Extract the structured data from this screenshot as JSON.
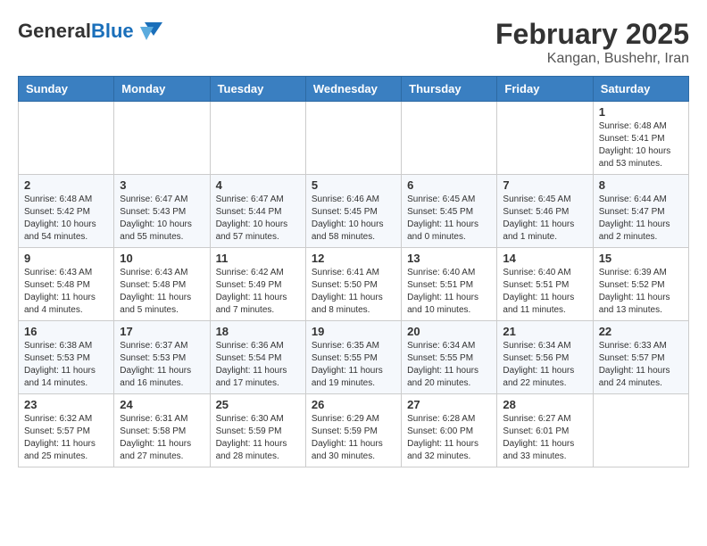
{
  "header": {
    "logo_general": "General",
    "logo_blue": "Blue",
    "month_year": "February 2025",
    "location": "Kangan, Bushehr, Iran"
  },
  "weekdays": [
    "Sunday",
    "Monday",
    "Tuesday",
    "Wednesday",
    "Thursday",
    "Friday",
    "Saturday"
  ],
  "weeks": [
    [
      {
        "day": "",
        "info": ""
      },
      {
        "day": "",
        "info": ""
      },
      {
        "day": "",
        "info": ""
      },
      {
        "day": "",
        "info": ""
      },
      {
        "day": "",
        "info": ""
      },
      {
        "day": "",
        "info": ""
      },
      {
        "day": "1",
        "info": "Sunrise: 6:48 AM\nSunset: 5:41 PM\nDaylight: 10 hours\nand 53 minutes."
      }
    ],
    [
      {
        "day": "2",
        "info": "Sunrise: 6:48 AM\nSunset: 5:42 PM\nDaylight: 10 hours\nand 54 minutes."
      },
      {
        "day": "3",
        "info": "Sunrise: 6:47 AM\nSunset: 5:43 PM\nDaylight: 10 hours\nand 55 minutes."
      },
      {
        "day": "4",
        "info": "Sunrise: 6:47 AM\nSunset: 5:44 PM\nDaylight: 10 hours\nand 57 minutes."
      },
      {
        "day": "5",
        "info": "Sunrise: 6:46 AM\nSunset: 5:45 PM\nDaylight: 10 hours\nand 58 minutes."
      },
      {
        "day": "6",
        "info": "Sunrise: 6:45 AM\nSunset: 5:45 PM\nDaylight: 11 hours\nand 0 minutes."
      },
      {
        "day": "7",
        "info": "Sunrise: 6:45 AM\nSunset: 5:46 PM\nDaylight: 11 hours\nand 1 minute."
      },
      {
        "day": "8",
        "info": "Sunrise: 6:44 AM\nSunset: 5:47 PM\nDaylight: 11 hours\nand 2 minutes."
      }
    ],
    [
      {
        "day": "9",
        "info": "Sunrise: 6:43 AM\nSunset: 5:48 PM\nDaylight: 11 hours\nand 4 minutes."
      },
      {
        "day": "10",
        "info": "Sunrise: 6:43 AM\nSunset: 5:48 PM\nDaylight: 11 hours\nand 5 minutes."
      },
      {
        "day": "11",
        "info": "Sunrise: 6:42 AM\nSunset: 5:49 PM\nDaylight: 11 hours\nand 7 minutes."
      },
      {
        "day": "12",
        "info": "Sunrise: 6:41 AM\nSunset: 5:50 PM\nDaylight: 11 hours\nand 8 minutes."
      },
      {
        "day": "13",
        "info": "Sunrise: 6:40 AM\nSunset: 5:51 PM\nDaylight: 11 hours\nand 10 minutes."
      },
      {
        "day": "14",
        "info": "Sunrise: 6:40 AM\nSunset: 5:51 PM\nDaylight: 11 hours\nand 11 minutes."
      },
      {
        "day": "15",
        "info": "Sunrise: 6:39 AM\nSunset: 5:52 PM\nDaylight: 11 hours\nand 13 minutes."
      }
    ],
    [
      {
        "day": "16",
        "info": "Sunrise: 6:38 AM\nSunset: 5:53 PM\nDaylight: 11 hours\nand 14 minutes."
      },
      {
        "day": "17",
        "info": "Sunrise: 6:37 AM\nSunset: 5:53 PM\nDaylight: 11 hours\nand 16 minutes."
      },
      {
        "day": "18",
        "info": "Sunrise: 6:36 AM\nSunset: 5:54 PM\nDaylight: 11 hours\nand 17 minutes."
      },
      {
        "day": "19",
        "info": "Sunrise: 6:35 AM\nSunset: 5:55 PM\nDaylight: 11 hours\nand 19 minutes."
      },
      {
        "day": "20",
        "info": "Sunrise: 6:34 AM\nSunset: 5:55 PM\nDaylight: 11 hours\nand 20 minutes."
      },
      {
        "day": "21",
        "info": "Sunrise: 6:34 AM\nSunset: 5:56 PM\nDaylight: 11 hours\nand 22 minutes."
      },
      {
        "day": "22",
        "info": "Sunrise: 6:33 AM\nSunset: 5:57 PM\nDaylight: 11 hours\nand 24 minutes."
      }
    ],
    [
      {
        "day": "23",
        "info": "Sunrise: 6:32 AM\nSunset: 5:57 PM\nDaylight: 11 hours\nand 25 minutes."
      },
      {
        "day": "24",
        "info": "Sunrise: 6:31 AM\nSunset: 5:58 PM\nDaylight: 11 hours\nand 27 minutes."
      },
      {
        "day": "25",
        "info": "Sunrise: 6:30 AM\nSunset: 5:59 PM\nDaylight: 11 hours\nand 28 minutes."
      },
      {
        "day": "26",
        "info": "Sunrise: 6:29 AM\nSunset: 5:59 PM\nDaylight: 11 hours\nand 30 minutes."
      },
      {
        "day": "27",
        "info": "Sunrise: 6:28 AM\nSunset: 6:00 PM\nDaylight: 11 hours\nand 32 minutes."
      },
      {
        "day": "28",
        "info": "Sunrise: 6:27 AM\nSunset: 6:01 PM\nDaylight: 11 hours\nand 33 minutes."
      },
      {
        "day": "",
        "info": ""
      }
    ]
  ]
}
